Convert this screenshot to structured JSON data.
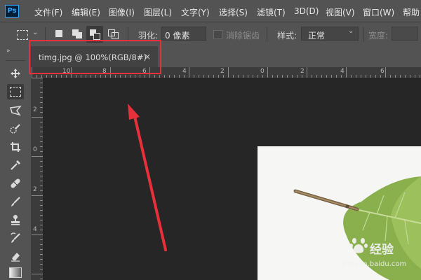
{
  "app": {
    "logo_text": "Ps"
  },
  "menu": [
    {
      "label": "文件(F)"
    },
    {
      "label": "编辑(E)"
    },
    {
      "label": "图像(I)"
    },
    {
      "label": "图层(L)"
    },
    {
      "label": "文字(Y)"
    },
    {
      "label": "选择(S)"
    },
    {
      "label": "滤镜(T)"
    },
    {
      "label": "3D(D)"
    },
    {
      "label": "视图(V)"
    },
    {
      "label": "窗口(W)"
    },
    {
      "label": "帮助"
    }
  ],
  "options": {
    "feather_label": "羽化:",
    "feather_value": "0 像素",
    "antialias_label": "消除锯齿",
    "style_label": "样式:",
    "style_value": "正常",
    "width_label": "宽度:"
  },
  "document": {
    "tab_title": "timg.jpg @ 100%(RGB/8#)",
    "close_symbol": "×"
  },
  "ruler_h_labels": [
    "10",
    "8",
    "6",
    "4",
    "2",
    "0",
    "2",
    "4",
    "6"
  ],
  "ruler_v_labels": [
    "2",
    "0",
    "2",
    "4"
  ],
  "watermark": {
    "text": "经验",
    "url": "jingyan.baidu.com"
  },
  "colors": {
    "highlight": "#e8303a",
    "arrow": "#e8303a",
    "accent": "#31a8ff",
    "canvas_bg": "#262626",
    "panel_bg": "#535353"
  }
}
